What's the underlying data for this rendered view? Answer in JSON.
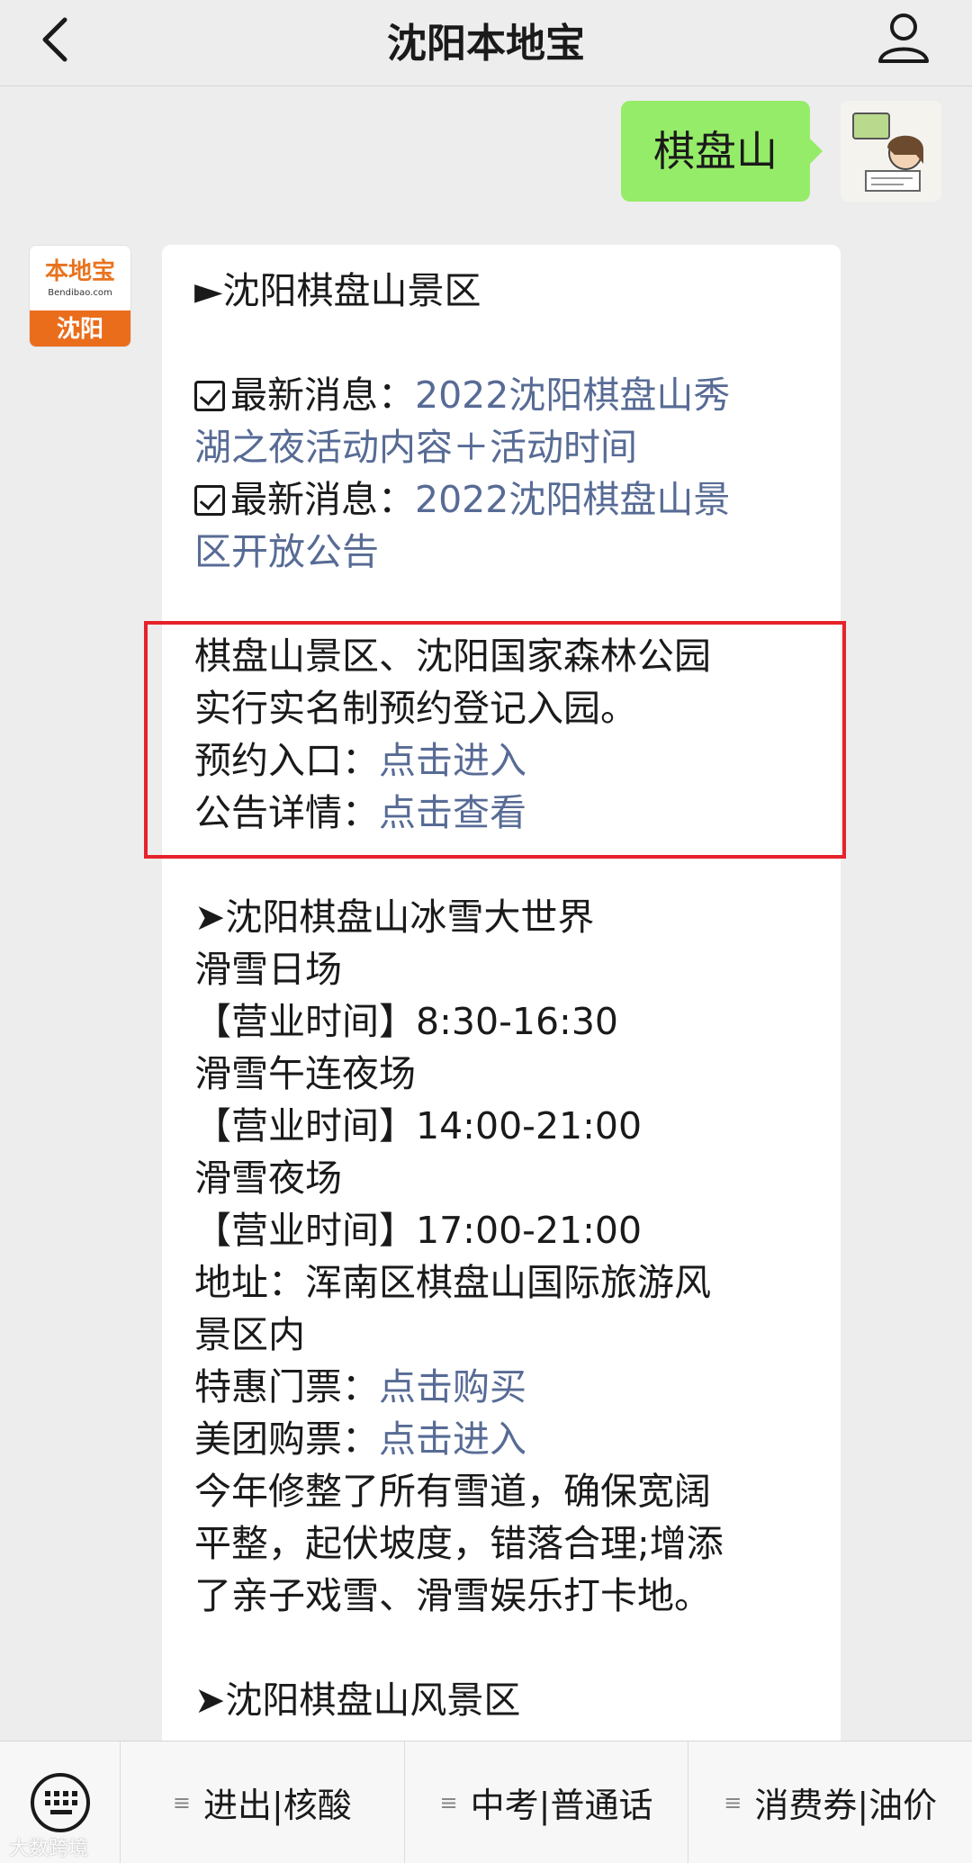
{
  "header": {
    "title": "沈阳本地宝"
  },
  "user_message": {
    "text": "棋盘山"
  },
  "bot_avatar": {
    "logo": "本地宝",
    "site": "Bendibao.com",
    "city": "沈阳"
  },
  "bot_message": {
    "section1_title": "►沈阳棋盘山景区",
    "news1_prefix": "最新消息：",
    "news1_link_a": "2022沈阳棋盘山秀",
    "news1_link_b": "湖之夜活动内容＋活动时间",
    "news2_prefix": "最新消息：",
    "news2_link_a": "2022沈阳棋盘山景",
    "news2_link_b": "区开放公告",
    "notice_a": "棋盘山景区、沈阳国家森林公园",
    "notice_b": "实行实名制预约登记入园。",
    "booking_label": "预约入口：",
    "booking_link": "点击进入",
    "detail_label": "公告详情：",
    "detail_link": "点击查看",
    "section2_title": "➤沈阳棋盘山冰雪大世界",
    "ski_day": "滑雪日场",
    "ski_day_hours": "【营业时间】8:30-16:30",
    "ski_noon_night": "滑雪午连夜场",
    "ski_noon_night_hours": "【营业时间】14:00-21:00",
    "ski_night": "滑雪夜场",
    "ski_night_hours": "【营业时间】17:00-21:00",
    "address_a": "地址：浑南区棋盘山国际旅游风",
    "address_b": "景区内",
    "ticket_label": "特惠门票：",
    "ticket_link": "点击购买",
    "meituan_label": "美团购票：",
    "meituan_link": "点击进入",
    "desc_a": "今年修整了所有雪道，确保宽阔",
    "desc_b": "平整，起伏坡度，错落合理;增添",
    "desc_c": "了亲子戏雪、滑雪娱乐打卡地。",
    "section3_title": "➤沈阳棋盘山风景区"
  },
  "bottom_menu": {
    "items": [
      {
        "label": "进出|核酸"
      },
      {
        "label": "中考|普通话"
      },
      {
        "label": "消费券|油价"
      }
    ]
  },
  "watermark": "大数跨境",
  "colors": {
    "link": "#576b95",
    "user_bubble": "#95ec69",
    "highlight_border": "#e6222a",
    "avatar_brand": "#ea6d1c"
  },
  "icons": {
    "back": "chevron-left-icon",
    "profile": "person-icon",
    "keyboard": "keyboard-icon",
    "menu": "menu-lines-icon",
    "checkbox": "checkbox-icon"
  }
}
